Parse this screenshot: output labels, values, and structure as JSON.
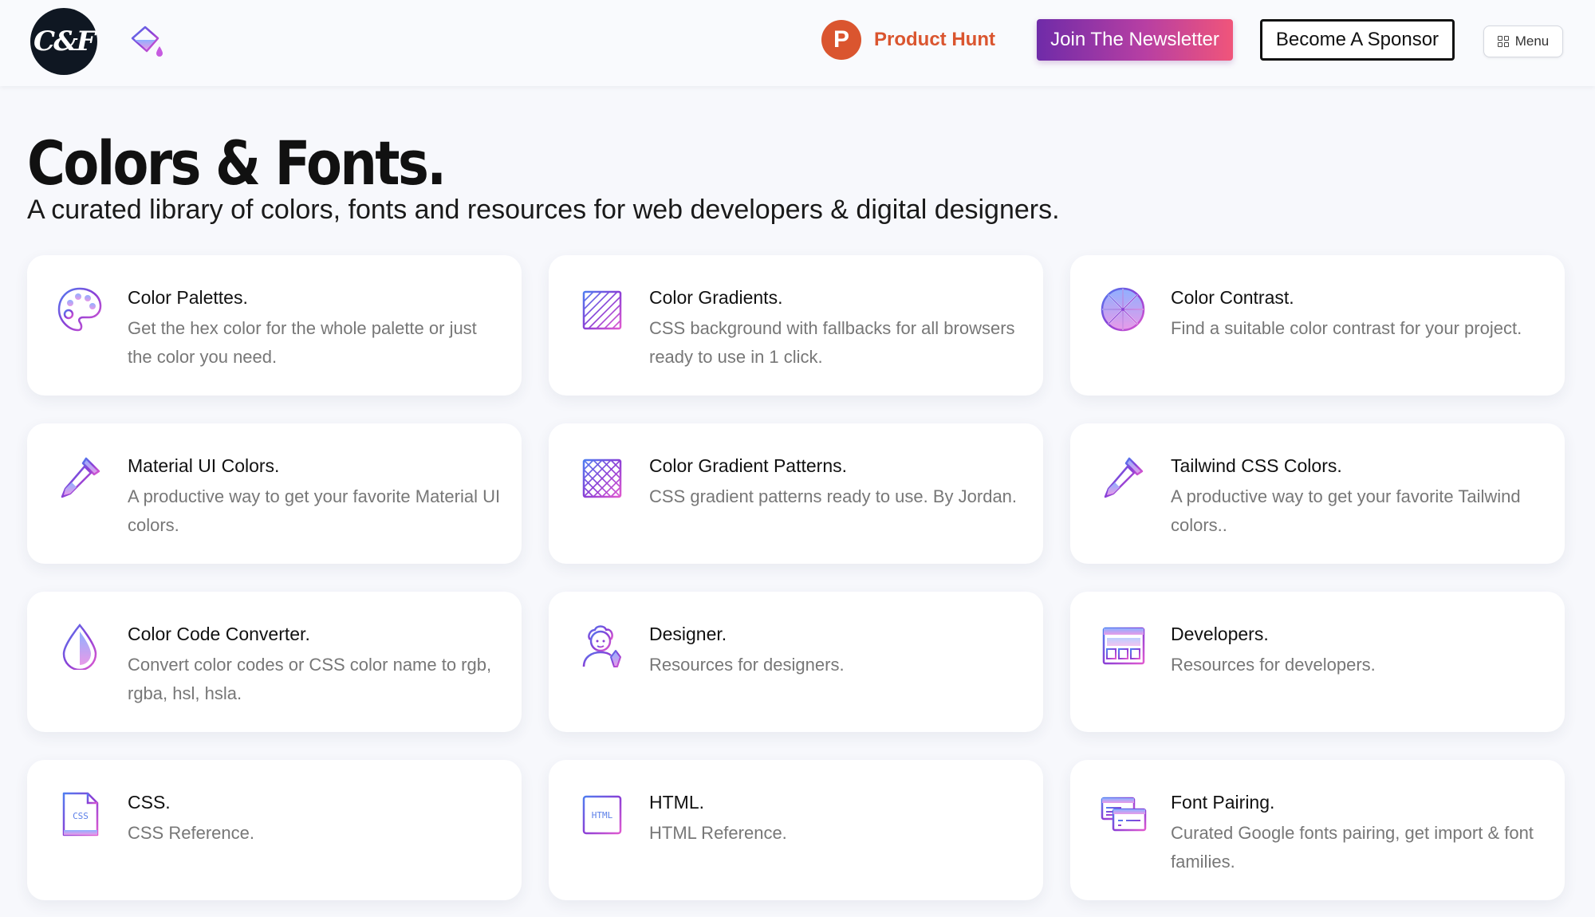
{
  "header": {
    "logo_text": "C&F",
    "product_hunt_letter": "P",
    "product_hunt_label": "Product Hunt",
    "newsletter_label": "Join The Newsletter",
    "sponsor_label": "Become A Sponsor",
    "menu_label": "Menu"
  },
  "hero": {
    "title": "Colors & Fonts.",
    "subtitle": "A curated library of colors, fonts and resources for web developers & digital designers."
  },
  "colors": {
    "product_hunt": "#da552f",
    "gradient_start": "#6f2ba8",
    "gradient_end": "#f0557a",
    "icon_purple": "#8a3fd6",
    "icon_blue": "#5b7fe8",
    "icon_pink": "#e05ad0"
  },
  "cards": [
    {
      "icon": "palette-icon",
      "title": "Color Palettes.",
      "desc": "Get the hex color for the whole palette or just the color you need."
    },
    {
      "icon": "gradient-swatch-icon",
      "title": "Color Gradients.",
      "desc": "CSS background with fallbacks for all browsers ready to use in 1 click."
    },
    {
      "icon": "color-wheel-icon",
      "title": "Color Contrast.",
      "desc": "Find a suitable color contrast for your project."
    },
    {
      "icon": "eyedropper-icon",
      "title": "Material UI Colors.",
      "desc": "A productive way to get your favorite Material UI colors."
    },
    {
      "icon": "pattern-grid-icon",
      "title": "Color Gradient Patterns.",
      "desc": "CSS gradient patterns ready to use. By Jordan."
    },
    {
      "icon": "eyedropper-icon",
      "title": "Tailwind CSS Colors.",
      "desc": "A productive way to get your favorite Tailwind colors.."
    },
    {
      "icon": "water-drop-icon",
      "title": "Color Code Converter.",
      "desc": "Convert color codes or CSS color name to rgb, rgba, hsl, hsla."
    },
    {
      "icon": "designer-icon",
      "title": "Designer.",
      "desc": "Resources for designers."
    },
    {
      "icon": "browser-window-icon",
      "title": "Developers.",
      "desc": "Resources for developers."
    },
    {
      "icon": "css-file-icon",
      "title": "CSS.",
      "desc": "CSS Reference."
    },
    {
      "icon": "html-file-icon",
      "title": "HTML.",
      "desc": "HTML Reference."
    },
    {
      "icon": "font-cards-icon",
      "title": "Font Pairing.",
      "desc": "Curated Google fonts pairing, get import & font families."
    }
  ]
}
